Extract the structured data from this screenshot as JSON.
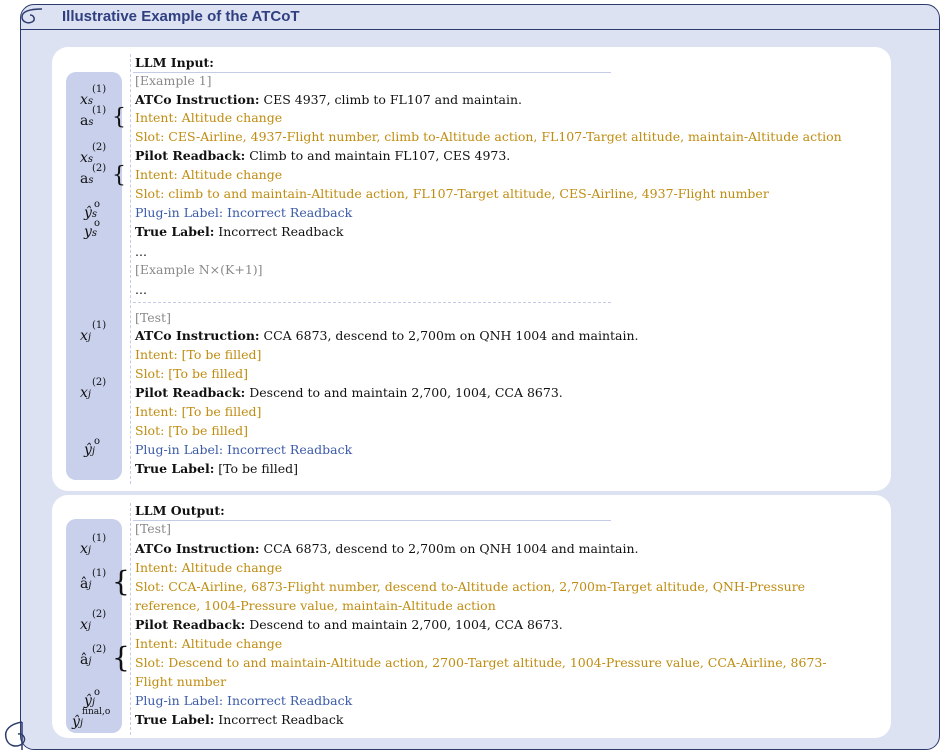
{
  "title": "Illustrative Example of the ATCoT",
  "input_panel": {
    "heading": "LLM Input:",
    "example_tag": "[Example 1]",
    "lines": [
      {
        "label": "ATCo Instruction:",
        "text": " CES 4937, climb to FL107 and maintain."
      },
      {
        "text": "Intent: Altitude change"
      },
      {
        "text": "Slot: CES-Airline, 4937-Flight number, climb to-Altitude action, FL107-Target altitude, maintain-Altitude action"
      },
      {
        "label": "Pilot Readback:",
        "text": " Climb to and maintain FL107, CES 4973."
      },
      {
        "text": "Intent: Altitude change"
      },
      {
        "text": "Slot: climb to and maintain-Altitude action, FL107-Target altitude, CES-Airline, 4937-Flight number"
      },
      {
        "text": "Plug-in Label: Incorrect Readback"
      },
      {
        "label": "True Label:",
        "text": " Incorrect Readback"
      }
    ],
    "ellipsis": "...",
    "example_n_tag": "[Example N×(K+1)]",
    "test_tag": "[Test]",
    "test_lines": [
      {
        "label": "ATCo Instruction:",
        "text": " CCA 6873, descend to 2,700m on QNH 1004 and maintain."
      },
      {
        "text": "Intent: [To be filled]"
      },
      {
        "text": "Slot: [To be filled]"
      },
      {
        "label": "Pilot Readback:",
        "text": " Descend to and maintain 2,700, 1004, CCA 8673."
      },
      {
        "text": "Intent: [To be filled]"
      },
      {
        "text": "Slot: [To be filled]"
      },
      {
        "text": "Plug-in Label: Incorrect Readback"
      },
      {
        "label": "True Label:",
        "text": " [To be filled]"
      }
    ]
  },
  "output_panel": {
    "heading": "LLM Output:",
    "test_tag": "[Test]",
    "lines": [
      {
        "label": "ATCo Instruction:",
        "text": " CCA 6873, descend to 2,700m on QNH 1004 and maintain."
      },
      {
        "text": "Intent: Altitude change"
      },
      {
        "text": "Slot: CCA-Airline, 6873-Flight number, descend to-Altitude action, 2,700m-Target altitude, QNH-Pressure"
      },
      {
        "text": "reference, 1004-Pressure value, maintain-Altitude action"
      },
      {
        "label": "Pilot Readback:",
        "text": " Descend to and maintain 2,700, 1004, CCA 8673."
      },
      {
        "text": "Intent: Altitude change"
      },
      {
        "text": "Slot: Descend to and maintain-Altitude action, 2700-Target altitude, 1004-Pressure value, CCA-Airline, 8673-"
      },
      {
        "text": "Flight number"
      },
      {
        "text": "Plug-in Label: Incorrect Readback"
      },
      {
        "label": "True Label:",
        "text": " Incorrect Readback"
      }
    ]
  },
  "variables": {
    "x": "x",
    "a": "a",
    "y": "y",
    "sub_s": "s",
    "sub_j": "j",
    "sup_1": "(1)",
    "sup_2": "(2)",
    "sup_o": "o",
    "sup_final": "final,o",
    "hat_a": "â",
    "hat_y": "ŷ"
  },
  "colors": {
    "intent_slot": "#bf8c10",
    "plugin_label": "#3b5aa8",
    "example_tag": "#8a8a8a",
    "frame": "#2c3a6e",
    "background": "#dde2f2",
    "var_column": "#c8d0ec"
  }
}
